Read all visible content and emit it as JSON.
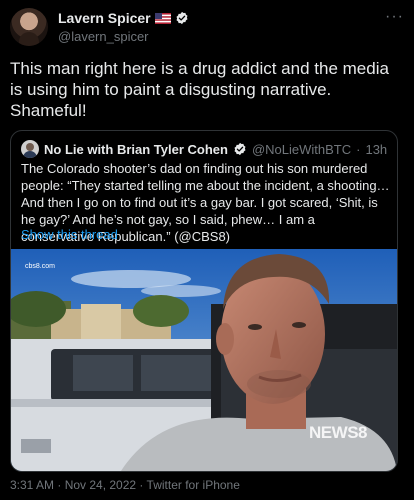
{
  "author": {
    "name": "Lavern Spicer",
    "handle": "@lavern_spicer",
    "flag_icon": "us-flag-icon",
    "verified_icon": "verified-badge-icon"
  },
  "more_label": "···",
  "tweet_text": "This man right here is a drug addict and the media is using him to paint a disgusting narrative. Shameful!",
  "quoted": {
    "name": "No Lie with Brian Tyler Cohen",
    "handle": "@NoLieWithBTC",
    "separator": "·",
    "age": "13h",
    "text": "The Colorado shooter’s dad on finding out his son murdered people: “They started telling me about the incident, a shooting… And then I go on to find out it’s a gay bar. I got scared, ‘Shit, is he gay?’ And he’s not gay, so I said, phew… I am a conservative Republican.” (@CBS8)",
    "show_thread": "Show this thread",
    "media": {
      "watermark_top": "cbs8.com",
      "watermark_logo": "NEWS8"
    }
  },
  "meta": {
    "timestamp": "3:31 AM · Nov 24, 2022 · Twitter for iPhone"
  },
  "colors": {
    "background": "#000000",
    "text": "#e7e9ea",
    "muted": "#71767b",
    "link": "#1d9bf0",
    "verified": "#1d9bf0"
  }
}
